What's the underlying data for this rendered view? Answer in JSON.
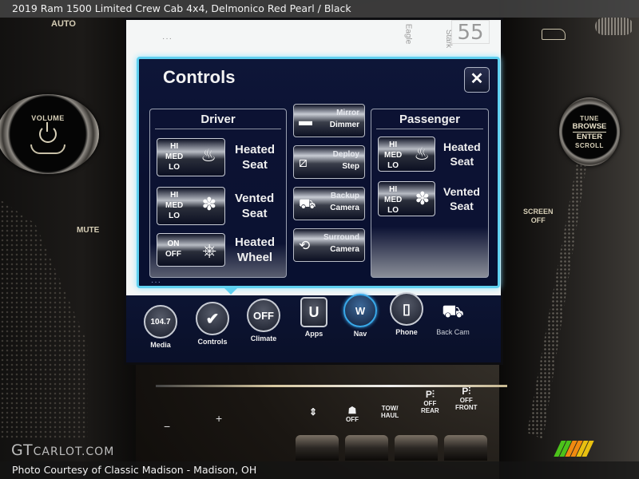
{
  "photo": {
    "title": "2019 Ram 1500 Limited Crew Cab 4x4,  Delmonico Red Pearl / Black",
    "credit": "Photo Courtesy of Classic Madison - Madison, OH",
    "watermark_big": "GT",
    "watermark_small": "CARLOT.COM",
    "logo_colors": [
      "#4cc21a",
      "#4cc21a",
      "#f08a10",
      "#f08a10",
      "#e8c010",
      "#e8c010"
    ]
  },
  "dashboard": {
    "auto_label": "AUTO",
    "volume_knob": {
      "label": "VOLUME",
      "icon": "power-icon"
    },
    "mute_label": "MUTE",
    "tune_knob": {
      "top": "TUNE",
      "line1": "BROWSE",
      "line2": "ENTER",
      "bottom": "SCROLL"
    },
    "screen_off_label": "SCREEN OFF",
    "screen_off_line1": "SCREEN",
    "screen_off_line2": "OFF",
    "switches": [
      {
        "name": "air-suspension",
        "icon": "suspension-icon",
        "line1": "",
        "line2": ""
      },
      {
        "name": "stability-off",
        "icon": "traction-off-icon",
        "line1": "OFF",
        "line2": ""
      },
      {
        "name": "tow-haul",
        "icon": "",
        "line1": "TOW/",
        "line2": "HAUL"
      },
      {
        "name": "park-assist-rear",
        "icon": "park-sensor-icon",
        "line1": "OFF",
        "line2": "REAR"
      },
      {
        "name": "park-assist-front",
        "icon": "park-sensor-icon",
        "line1": "OFF",
        "line2": "FRONT"
      }
    ],
    "plus_label": "+",
    "minus_label": "−"
  },
  "screen": {
    "map": {
      "speed_limit": "55",
      "road1": "Eagle",
      "road2": "Stark"
    },
    "modal": {
      "title": "Controls",
      "close_label": "✕",
      "driver": {
        "title": "Driver",
        "items": [
          {
            "label_l1": "Heated",
            "label_l2": "Seat",
            "levels": [
              "HI",
              "MED",
              "LO"
            ],
            "icon": "heated-seat-icon",
            "glyph": "♨"
          },
          {
            "label_l1": "Vented",
            "label_l2": "Seat",
            "levels": [
              "HI",
              "MED",
              "LO"
            ],
            "icon": "vented-seat-icon",
            "glyph": "✽"
          },
          {
            "label_l1": "Heated",
            "label_l2": "Wheel",
            "levels": [
              "ON",
              "OFF"
            ],
            "icon": "heated-wheel-icon",
            "glyph": "⎈"
          }
        ]
      },
      "middle": [
        {
          "l1": "Mirror",
          "l2": "Dimmer",
          "icon": "mirror-dimmer-icon",
          "glyph": "▬"
        },
        {
          "l1": "Deploy",
          "l2": "Step",
          "icon": "deploy-step-icon",
          "glyph": "⧄"
        },
        {
          "l1": "Backup",
          "l2": "Camera",
          "icon": "backup-camera-icon",
          "glyph": "⛟"
        },
        {
          "l1": "Surround",
          "l2": "Camera",
          "icon": "surround-camera-icon",
          "glyph": "⟲"
        }
      ],
      "passenger": {
        "title": "Passenger",
        "items": [
          {
            "label_l1": "Heated",
            "label_l2": "Seat",
            "levels": [
              "HI",
              "MED",
              "LO"
            ],
            "icon": "heated-seat-icon",
            "glyph": "♨"
          },
          {
            "label_l1": "Vented",
            "label_l2": "Seat",
            "levels": [
              "HI",
              "MED",
              "LO"
            ],
            "icon": "vented-seat-icon",
            "glyph": "✽"
          }
        ]
      }
    },
    "navbar": {
      "active": "Controls",
      "items": [
        {
          "label": "Media",
          "icon_text": "104.7",
          "icon": "radio-frequency-icon"
        },
        {
          "label": "Controls",
          "icon_text": "✔",
          "icon": "controls-seat-icon"
        },
        {
          "label": "Climate",
          "icon_text": "OFF",
          "icon": "climate-off-icon"
        },
        {
          "label": "Apps",
          "icon_text": "U",
          "icon": "apps-icon"
        },
        {
          "label": "Nav",
          "icon_text": "W",
          "icon": "compass-icon"
        },
        {
          "label": "Phone",
          "icon_text": "▯",
          "icon": "phone-icon"
        },
        {
          "label": "Back Cam",
          "icon_text": "⛟",
          "icon": "back-camera-truck-icon"
        }
      ]
    }
  }
}
